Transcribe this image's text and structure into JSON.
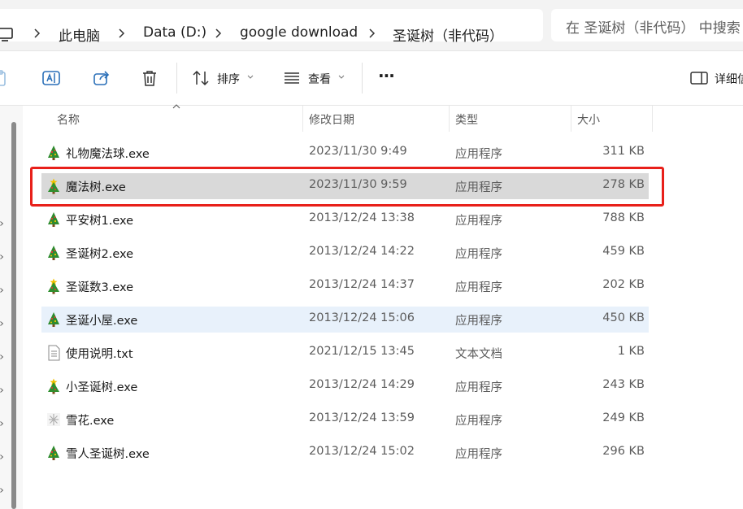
{
  "address": {
    "breadcrumbs": [
      "此电脑",
      "Data (D:)",
      "google download",
      "圣诞树（非代码）"
    ],
    "search_placeholder": "在 圣诞树（非代码） 中搜索"
  },
  "toolbar": {
    "sort_label": "排序",
    "view_label": "查看",
    "more_label": "···",
    "details_label": "详细信息"
  },
  "columns": {
    "name": "名称",
    "date": "修改日期",
    "type": "类型",
    "size": "大小"
  },
  "files": [
    {
      "name": "礼物魔法球.exe",
      "date": "2023/11/30 9:49",
      "type": "应用程序",
      "size": "311 KB",
      "icon": "tree-app-icon"
    },
    {
      "name": "魔法树.exe",
      "date": "2023/11/30 9:59",
      "type": "应用程序",
      "size": "278 KB",
      "icon": "star-tree-app-icon"
    },
    {
      "name": "平安树1.exe",
      "date": "2013/12/24 13:38",
      "type": "应用程序",
      "size": "788 KB",
      "icon": "tree-app-icon"
    },
    {
      "name": "圣诞树2.exe",
      "date": "2013/12/24 14:22",
      "type": "应用程序",
      "size": "459 KB",
      "icon": "tree-app-icon"
    },
    {
      "name": "圣诞数3.exe",
      "date": "2013/12/24 14:37",
      "type": "应用程序",
      "size": "202 KB",
      "icon": "star-tree-app-icon"
    },
    {
      "name": "圣诞小屋.exe",
      "date": "2013/12/24 15:06",
      "type": "应用程序",
      "size": "450 KB",
      "icon": "tree-app-icon"
    },
    {
      "name": "使用说明.txt",
      "date": "2021/12/15 13:45",
      "type": "文本文档",
      "size": "1 KB",
      "icon": "text-file-icon"
    },
    {
      "name": "小圣诞树.exe",
      "date": "2013/12/24 14:29",
      "type": "应用程序",
      "size": "243 KB",
      "icon": "star-tree-app-icon"
    },
    {
      "name": "雪花.exe",
      "date": "2013/12/24 13:59",
      "type": "应用程序",
      "size": "249 KB",
      "icon": "snowflake-app-icon"
    },
    {
      "name": "雪人圣诞树.exe",
      "date": "2013/12/24 15:02",
      "type": "应用程序",
      "size": "296 KB",
      "icon": "tree-app-icon"
    }
  ],
  "selected_index": 1,
  "hover_index": 5,
  "colors": {
    "highlight_box": "#e8201a",
    "selected_row": "#d9d9d9",
    "hover_row": "#e8f1fb"
  }
}
